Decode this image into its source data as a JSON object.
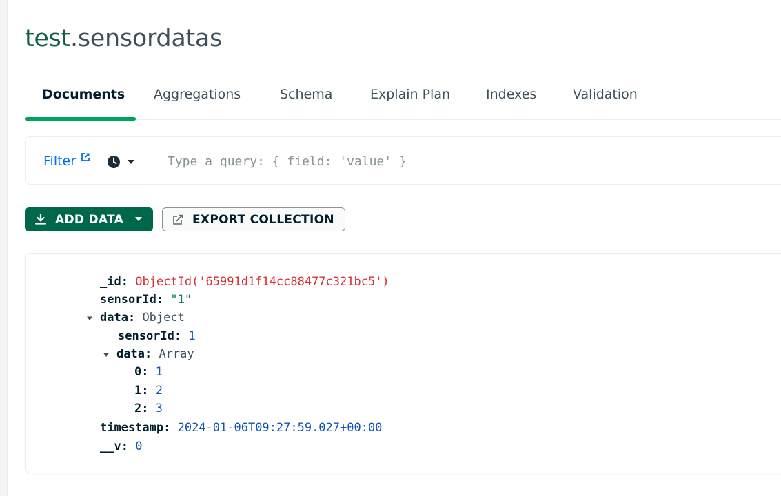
{
  "header": {
    "db_name": "test",
    "separator": ".",
    "collection_name": "sensordatas"
  },
  "tabs": [
    {
      "label": "Documents",
      "active": true
    },
    {
      "label": "Aggregations",
      "active": false
    },
    {
      "label": "Schema",
      "active": false
    },
    {
      "label": "Explain Plan",
      "active": false
    },
    {
      "label": "Indexes",
      "active": false
    },
    {
      "label": "Validation",
      "active": false
    }
  ],
  "filter": {
    "label": "Filter",
    "placeholder": "Type a query: { field: 'value' }",
    "value": ""
  },
  "toolbar": {
    "add_data_label": "ADD DATA",
    "export_label": "EXPORT COLLECTION"
  },
  "document": {
    "id_key": "_id",
    "id_value": "ObjectId('65991d1f14cc88477c321bc5')",
    "sensorId_key": "sensorId",
    "sensorId_value": "\"1\"",
    "data_key": "data",
    "data_type": "Object",
    "nested_sensorId_key": "sensorId",
    "nested_sensorId_value": "1",
    "nested_data_key": "data",
    "nested_data_type": "Array",
    "array_items": [
      {
        "index": "0",
        "value": "1"
      },
      {
        "index": "1",
        "value": "2"
      },
      {
        "index": "2",
        "value": "3"
      }
    ],
    "timestamp_key": "timestamp",
    "timestamp_value": "2024-01-06T09:27:59.027+00:00",
    "v_key": "__v",
    "v_value": "0"
  },
  "colors": {
    "brand_green": "#00684a",
    "tab_underline": "#00a35c",
    "link_blue": "#016bf8",
    "oid_red": "#db3030",
    "string_green": "#12824d",
    "number_blue": "#1254b7"
  }
}
